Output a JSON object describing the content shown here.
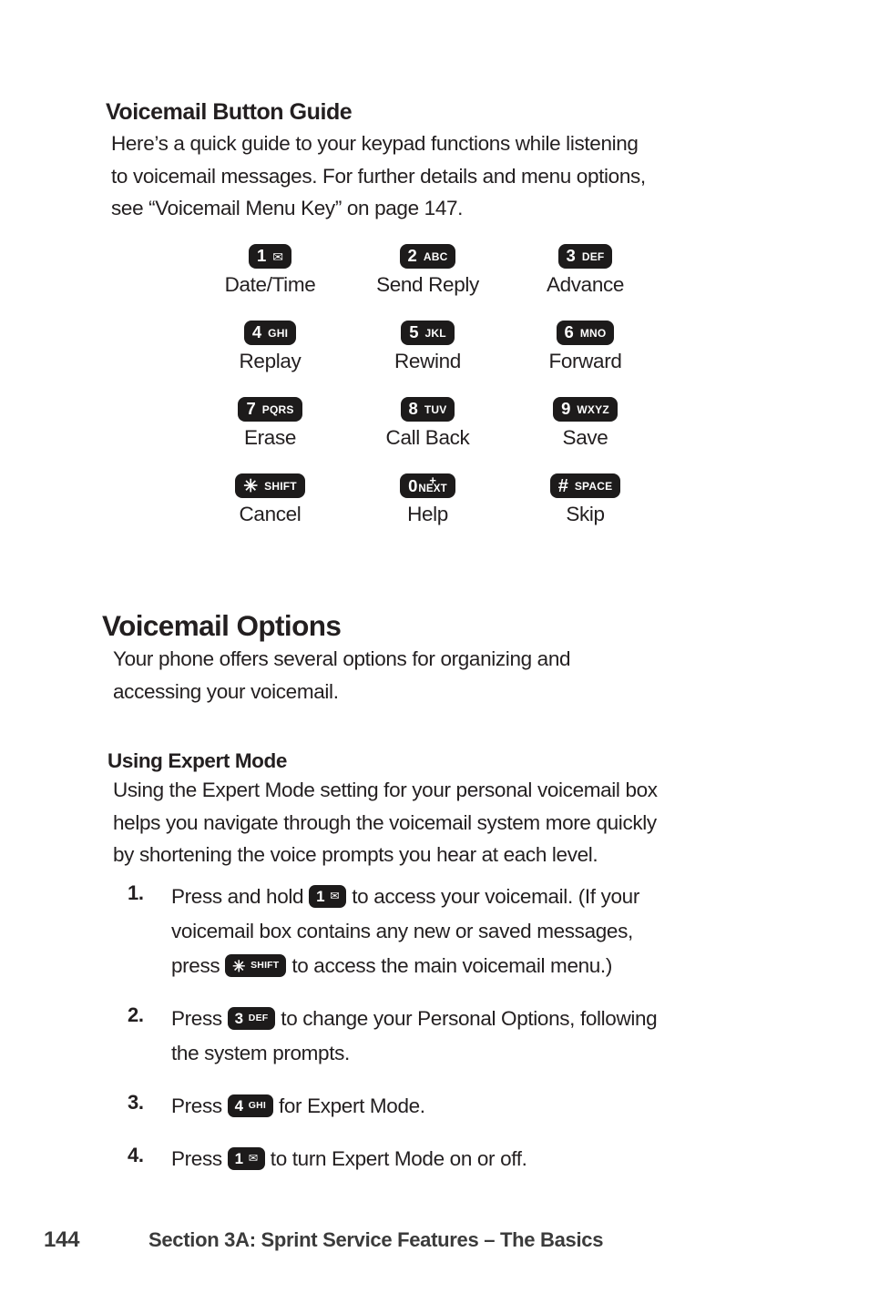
{
  "page": {
    "number": "144",
    "section_footer": "Section 3A: Sprint Service Features – The Basics",
    "background": "#ffffff",
    "text_color": "#231f20",
    "key_color": "#1d1b1b",
    "key_text_color": "#ffffff"
  },
  "button_guide": {
    "heading": "Voicemail Button Guide",
    "intro_lines": [
      "Here’s a quick guide to your keypad functions while listening",
      "to voicemail messages. For further details and menu options,",
      "see “Voicemail Menu Key” on page 147."
    ],
    "keys": [
      {
        "num": "1",
        "sub": "",
        "icon": "envelope-icon",
        "label": "Date/Time"
      },
      {
        "num": "2",
        "sub": "ABC",
        "icon": "",
        "label": "Send Reply"
      },
      {
        "num": "3",
        "sub": "DEF",
        "icon": "",
        "label": "Advance"
      },
      {
        "num": "4",
        "sub": "GHI",
        "icon": "",
        "label": "Replay"
      },
      {
        "num": "5",
        "sub": "JKL",
        "icon": "",
        "label": "Rewind"
      },
      {
        "num": "6",
        "sub": "MNO",
        "icon": "",
        "label": "Forward"
      },
      {
        "num": "7",
        "sub": "PQRS",
        "icon": "",
        "label": "Erase"
      },
      {
        "num": "8",
        "sub": "TUV",
        "icon": "",
        "label": "Call Back"
      },
      {
        "num": "9",
        "sub": "WXYZ",
        "icon": "",
        "label": "Save"
      },
      {
        "num": "✳",
        "sub": "SHIFT",
        "icon": "star-key-icon",
        "label": "Cancel"
      },
      {
        "num": "0",
        "sub": "NEXT",
        "icon": "plus-superscript",
        "label": "Help"
      },
      {
        "num": "#",
        "sub": "SPACE",
        "icon": "hash-key-icon",
        "label": "Skip"
      }
    ]
  },
  "voicemail_options": {
    "heading": "Voicemail Options",
    "intro_lines": [
      "Your phone offers several options for organizing and",
      "accessing your voicemail."
    ]
  },
  "expert_mode": {
    "heading": "Using Expert Mode",
    "intro_lines": [
      "Using the Expert Mode setting for your personal voicemail box",
      "helps you navigate through the voicemail system more quickly",
      "by shortening the voice prompts you hear at each level."
    ],
    "steps": [
      {
        "number": "1.",
        "line1_pre": "Press and hold",
        "key1": {
          "num": "1",
          "sub": "",
          "icon": "envelope-icon"
        },
        "line1_post": "to access your voicemail. (If your",
        "line2": "voicemail box contains any new or saved messages,",
        "line3_pre": "press",
        "key2": {
          "num": "✳",
          "sub": "SHIFT",
          "icon": "star-key-icon"
        },
        "line3_post": "to access the main voicemail menu.)"
      },
      {
        "number": "2.",
        "line1_pre": "Press",
        "key1": {
          "num": "3",
          "sub": "DEF",
          "icon": ""
        },
        "line1_post": "to change your Personal Options, following",
        "line2": "the system prompts."
      },
      {
        "number": "3.",
        "line1_pre": "Press",
        "key1": {
          "num": "4",
          "sub": "GHI",
          "icon": ""
        },
        "line1_post": "for Expert Mode."
      },
      {
        "number": "4.",
        "line1_pre": "Press",
        "key1": {
          "num": "1",
          "sub": "",
          "icon": "envelope-icon"
        },
        "line1_post": "to turn Expert Mode on or off."
      }
    ]
  }
}
